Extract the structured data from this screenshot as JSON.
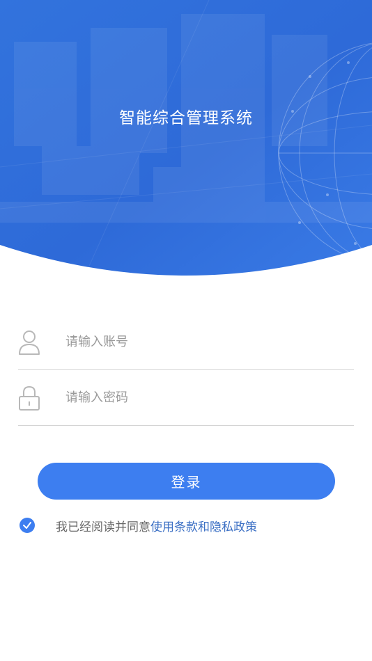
{
  "header": {
    "title": "智能综合管理系统"
  },
  "form": {
    "account_placeholder": "请输入账号",
    "password_placeholder": "请输入密码",
    "login_label": "登录"
  },
  "agreement": {
    "text": "我已经阅读并同意",
    "link": "使用条款和隐私政策",
    "checked": true
  },
  "colors": {
    "hero_blue": "#2d6fe0",
    "button_blue": "#3d7ef0",
    "link_blue": "#3b6fc4"
  },
  "icons": {
    "account": "user-icon",
    "password": "lock-icon",
    "agree": "checkmark-icon"
  }
}
